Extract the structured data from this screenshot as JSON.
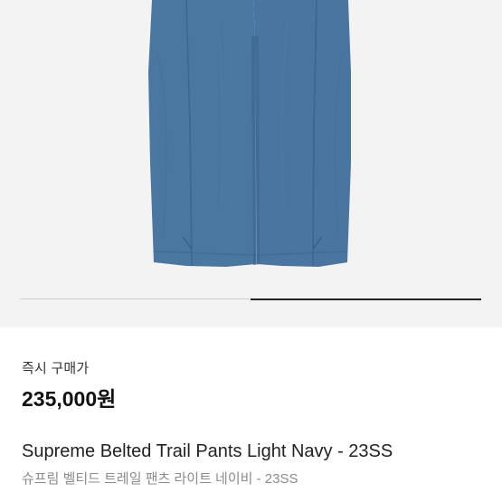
{
  "product": {
    "image_name": "navy-pants-photo",
    "pants_color": "#4a77a0",
    "background_color": "#f3f3f3",
    "carousel": {
      "total_images": 2,
      "active_index": 2
    }
  },
  "pricing": {
    "label": "즉시 구매가",
    "value": "235,000원"
  },
  "title": {
    "english": "Supreme Belted Trail Pants Light Navy - 23SS",
    "korean": "슈프림 벨티드 트레일 팬츠 라이트 네이비 - 23SS"
  }
}
